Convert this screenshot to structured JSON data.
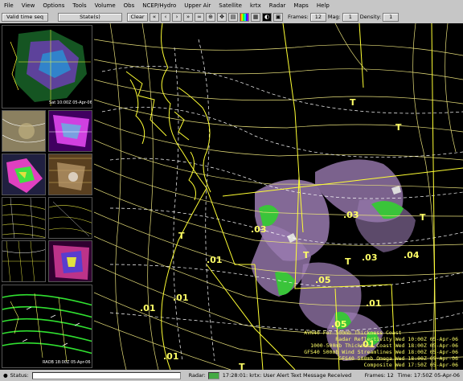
{
  "menu": [
    "File",
    "View",
    "Options",
    "Tools",
    "Volume",
    "Obs",
    "NCEP/Hydro",
    "Upper Air",
    "Satellite",
    "krtx",
    "Radar",
    "Maps",
    "Help"
  ],
  "toolbar": {
    "loop_mode": "Valid time seq",
    "scale": "State(s)",
    "clear": "Clear",
    "frames_label": "Frames:",
    "frames_value": "12",
    "mag_label": "Mag:",
    "mag_value": "1",
    "density_label": "Density:",
    "density_value": "1"
  },
  "thumb_top_label": "Sat 10:00Z 05-Apr-06",
  "thumb_bottom_label": "RAOB 18:00Z 05-Apr-06",
  "map_labels": {
    "t1": "T",
    "t2": "T",
    "t3": "T",
    "t4": "T",
    "t5": "T",
    "t6": "T",
    "t7": "T",
    "v1": ".01",
    "v2": ".01",
    "v3": ".01",
    "v4": ".01",
    "v5": ".03",
    "v6": ".03",
    "v7": ".03",
    "v8": ".04",
    "v9": ".05",
    "v10": ".05",
    "v11": ".01",
    "v12": ".01"
  },
  "legend": [
    "Radar Reflectivity  Wed 10:00Z 05-Apr-06",
    "1000-500mb Thickness Coast  Wed 18:00Z 05-Apr-06",
    "GFS40 500mb Wind Streamlines  Wed 18:00Z 05-Apr-06",
    "GFS40 500mb Omega  Wed 18:00Z 05-Apr-06",
    "Composite  Wed 17:50Z 05-Apr-06"
  ],
  "legend_partial": "AVN40 For 500mb Thickness Coast",
  "status": {
    "label": "Status:",
    "radar_label": "Radar:",
    "message": "17:28:01: krtx: User Alert Text Message Received",
    "frames_label": "Frames:",
    "frames_value": "12",
    "time_label": "Time:",
    "time_value": "17:50Z 05-Apr-06"
  },
  "colors": {
    "contour": "#e8e07a",
    "map_border": "#ffff33",
    "streamline": "#ffffff",
    "radar_purple": "#9a7bb0",
    "radar_green": "#3ac43a"
  }
}
